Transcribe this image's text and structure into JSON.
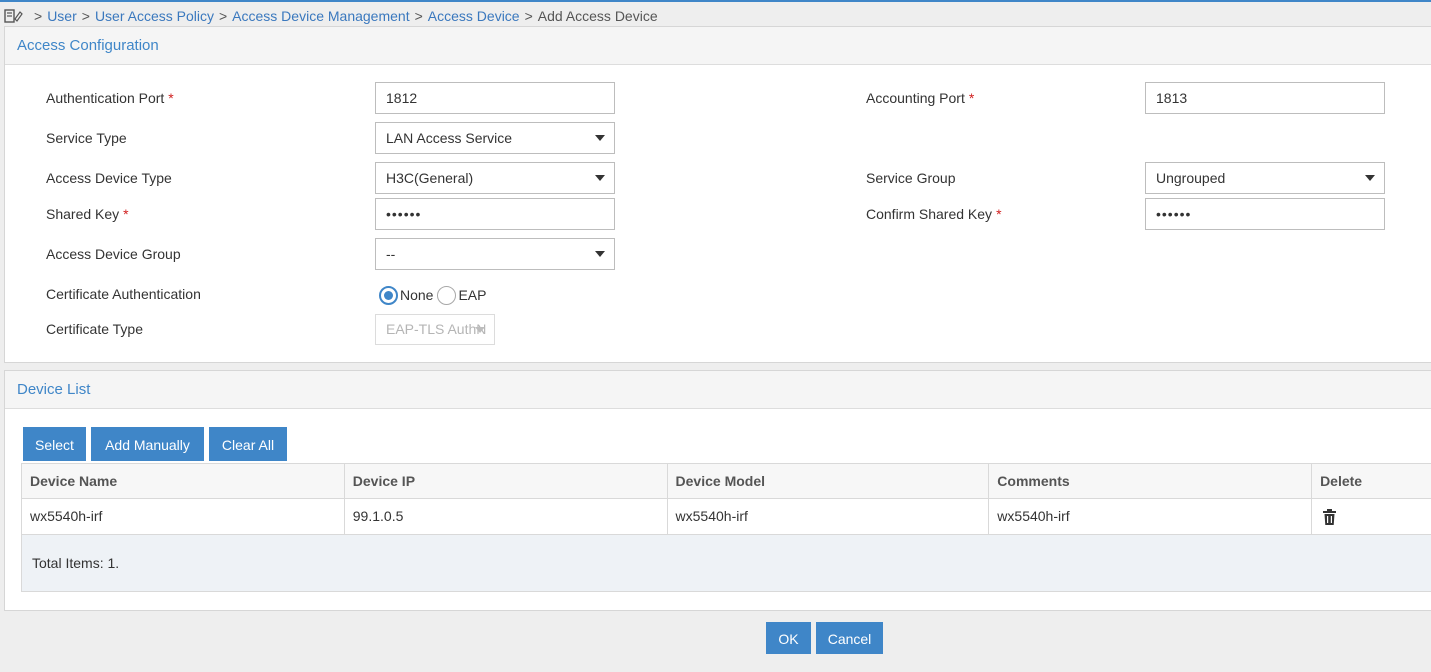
{
  "breadcrumb": {
    "items": [
      "User",
      "User Access Policy",
      "Access Device Management",
      "Access Device"
    ],
    "current": "Add Access Device",
    "separator": ">"
  },
  "access_panel": {
    "title": "Access Configuration",
    "auth_port": {
      "label": "Authentication Port",
      "value": "1812",
      "required": "*"
    },
    "acct_port": {
      "label": "Accounting Port",
      "value": "1813",
      "required": "*"
    },
    "service_type": {
      "label": "Service Type",
      "value": "LAN Access Service"
    },
    "device_type": {
      "label": "Access Device Type",
      "value": "H3C(General)"
    },
    "service_group": {
      "label": "Service Group",
      "value": "Ungrouped"
    },
    "shared_key": {
      "label": "Shared Key",
      "value": "••••••",
      "required": "*"
    },
    "confirm_key": {
      "label": "Confirm Shared Key",
      "value": "••••••",
      "required": "*"
    },
    "device_group": {
      "label": "Access Device Group",
      "value": "--"
    },
    "cert_auth": {
      "label": "Certificate Authentication",
      "options": [
        "None",
        "EAP"
      ],
      "selected": "None"
    },
    "cert_type": {
      "label": "Certificate Type",
      "value": "EAP-TLS AuthN"
    }
  },
  "device_panel": {
    "title": "Device List",
    "buttons": {
      "select": "Select",
      "add_manually": "Add Manually",
      "clear_all": "Clear All"
    },
    "columns": [
      "Device Name",
      "Device IP",
      "Device Model",
      "Comments",
      "Delete"
    ],
    "rows": [
      {
        "name": "wx5540h-irf",
        "ip": "99.1.0.5",
        "model": "wx5540h-irf",
        "comments": "wx5540h-irf",
        "delete_icon": "trash-icon"
      }
    ],
    "total": "Total Items: 1."
  },
  "footer": {
    "ok": "OK",
    "cancel": "Cancel"
  },
  "colors": {
    "accent": "#3f86c8",
    "required": "#d02020",
    "header_bg": "#f5f5f5"
  }
}
